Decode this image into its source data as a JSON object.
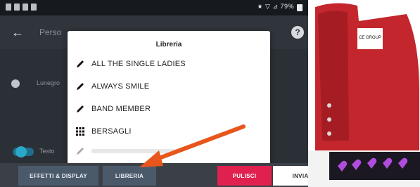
{
  "status_bar": {
    "right_text": "★ ▽ ⊿ 79%"
  },
  "app_bar": {
    "title": "Perso"
  },
  "background_rows": {
    "row1_label": "Lunegro",
    "row2_label": "Testo"
  },
  "dialog": {
    "title": "Libreria",
    "items": [
      {
        "label": "ALL THE SINGLE LADIES",
        "icon": "pencil-icon"
      },
      {
        "label": "ALWAYS SMILE",
        "icon": "pencil-icon"
      },
      {
        "label": "BAND MEMBER",
        "icon": "pencil-icon"
      },
      {
        "label": "BERSAGLI",
        "icon": "grid-icon"
      }
    ]
  },
  "bottom_bar": {
    "effetti_label": "EFFETTI & DISPLAY",
    "libreria_label": "LIBRERIA",
    "pulisci_label": "PULISCI",
    "invia_label": "INVIA"
  },
  "colors": {
    "accent_arrow": "#e8561c",
    "pulisci": "#e0204e",
    "tab_bg": "#4b5a6b",
    "shoe_red": "#c3262c",
    "led_purple": "#b04dde"
  },
  "product_photo": {
    "tag_text": "CE GROUP"
  }
}
